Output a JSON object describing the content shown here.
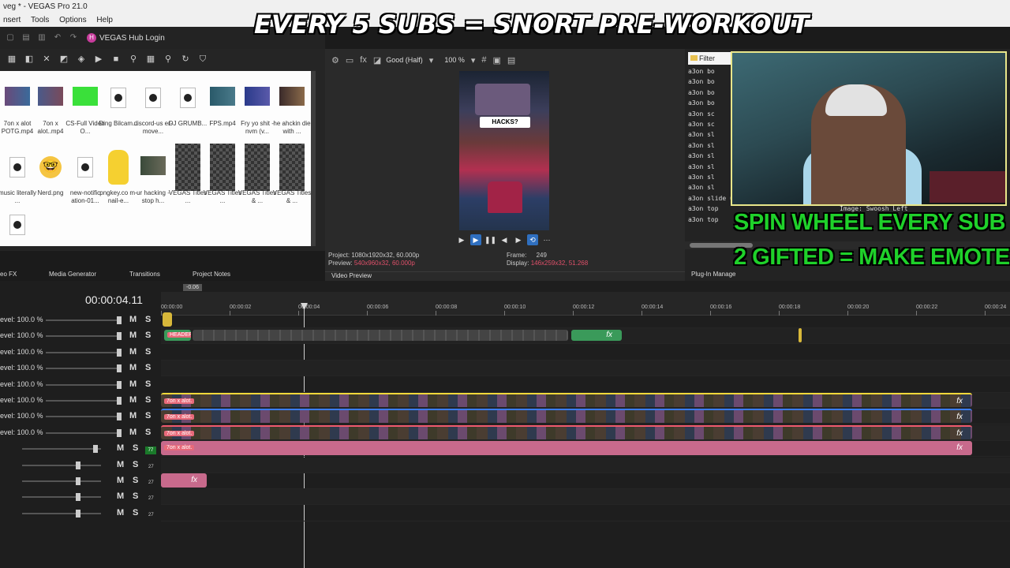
{
  "window": {
    "title": "veg * - VEGAS Pro 21.0"
  },
  "menu": {
    "items": [
      "nsert",
      "Tools",
      "Options",
      "Help"
    ]
  },
  "hub": {
    "label": "VEGAS Hub Login"
  },
  "overlays": {
    "title": "EVERY 5 SUBS = SNORT PRE-WORKOUT",
    "line1": "SPIN WHEEL EVERY SUB",
    "line2": "2 GIFTED = MAKE EMOTE"
  },
  "media": {
    "items": [
      {
        "label": "7on x alot POTG.mp4"
      },
      {
        "label": "7on x alot..mp4"
      },
      {
        "label": "CS-Full Video O..."
      },
      {
        "label": "Ding Bilcam..."
      },
      {
        "label": "discord-us er-move..."
      },
      {
        "label": "DJ GRUMB..."
      },
      {
        "label": "FPS.mp4"
      },
      {
        "label": "Fry yo shit - nvm (v..."
      },
      {
        "label": "he ahckin die with ..."
      },
      {
        "label": "music literally ..."
      },
      {
        "label": "Nerd.png"
      },
      {
        "label": "new-notific ation-01..."
      },
      {
        "label": "pngkey.co m-nail-e..."
      },
      {
        "label": "ur hacking - stop h..."
      },
      {
        "label": "VEGAS Titles ..."
      },
      {
        "label": "VEGAS Titles ..."
      },
      {
        "label": "VEGAS Titles & ..."
      },
      {
        "label": "VEGAS Titles & ..."
      }
    ]
  },
  "preview": {
    "quality": "Good (Half)",
    "zoom": "100 %",
    "overlay_text": "HACKS?",
    "project_label": "Project:",
    "project_value": "1080x1920x32, 60.000p",
    "preview_label": "Preview:",
    "preview_value": "540x960x32, 60.000p",
    "frame_label": "Frame:",
    "frame_value": "249",
    "display_label": "Display:",
    "display_value": "146x259x32, 51.268",
    "tab": "Video Preview"
  },
  "explorer": {
    "tab": "Filter",
    "files": [
      "a3on bo",
      "a3on bo",
      "a3on bo",
      "a3on bo",
      "a3on sc",
      "a3on sc",
      "a3on sl",
      "a3on sl",
      "a3on sl",
      "a3on sl",
      "a3on sl",
      "a3on sl",
      "a3on slide up B",
      "a3on top",
      "a3on top"
    ],
    "tooltip": "Image: Swoosh Left",
    "plugin_tab": "Plug-In Manage"
  },
  "dock_tabs": [
    "eo FX",
    "Media Generator",
    "Transitions",
    "Project Notes"
  ],
  "timeline": {
    "timecode": "00:00:04.11",
    "loop_label": "-0.06",
    "ruler_labels": [
      "00:00:00",
      "00:00:02",
      "00:00:04",
      "00:00:06",
      "00:00:08",
      "00:00:10",
      "00:00:12",
      "00:00:14",
      "00:00:16",
      "00:00:18",
      "00:00:20",
      "00:00:22",
      "00:00:24"
    ],
    "level_label": "evel: 100.0 %",
    "mute_label": "M",
    "solo_label": "S",
    "track_chip": "77",
    "track_num": "27",
    "clip_name": "7on x alot.",
    "title_clip_label": "HEADER",
    "fx_label": "fx"
  }
}
